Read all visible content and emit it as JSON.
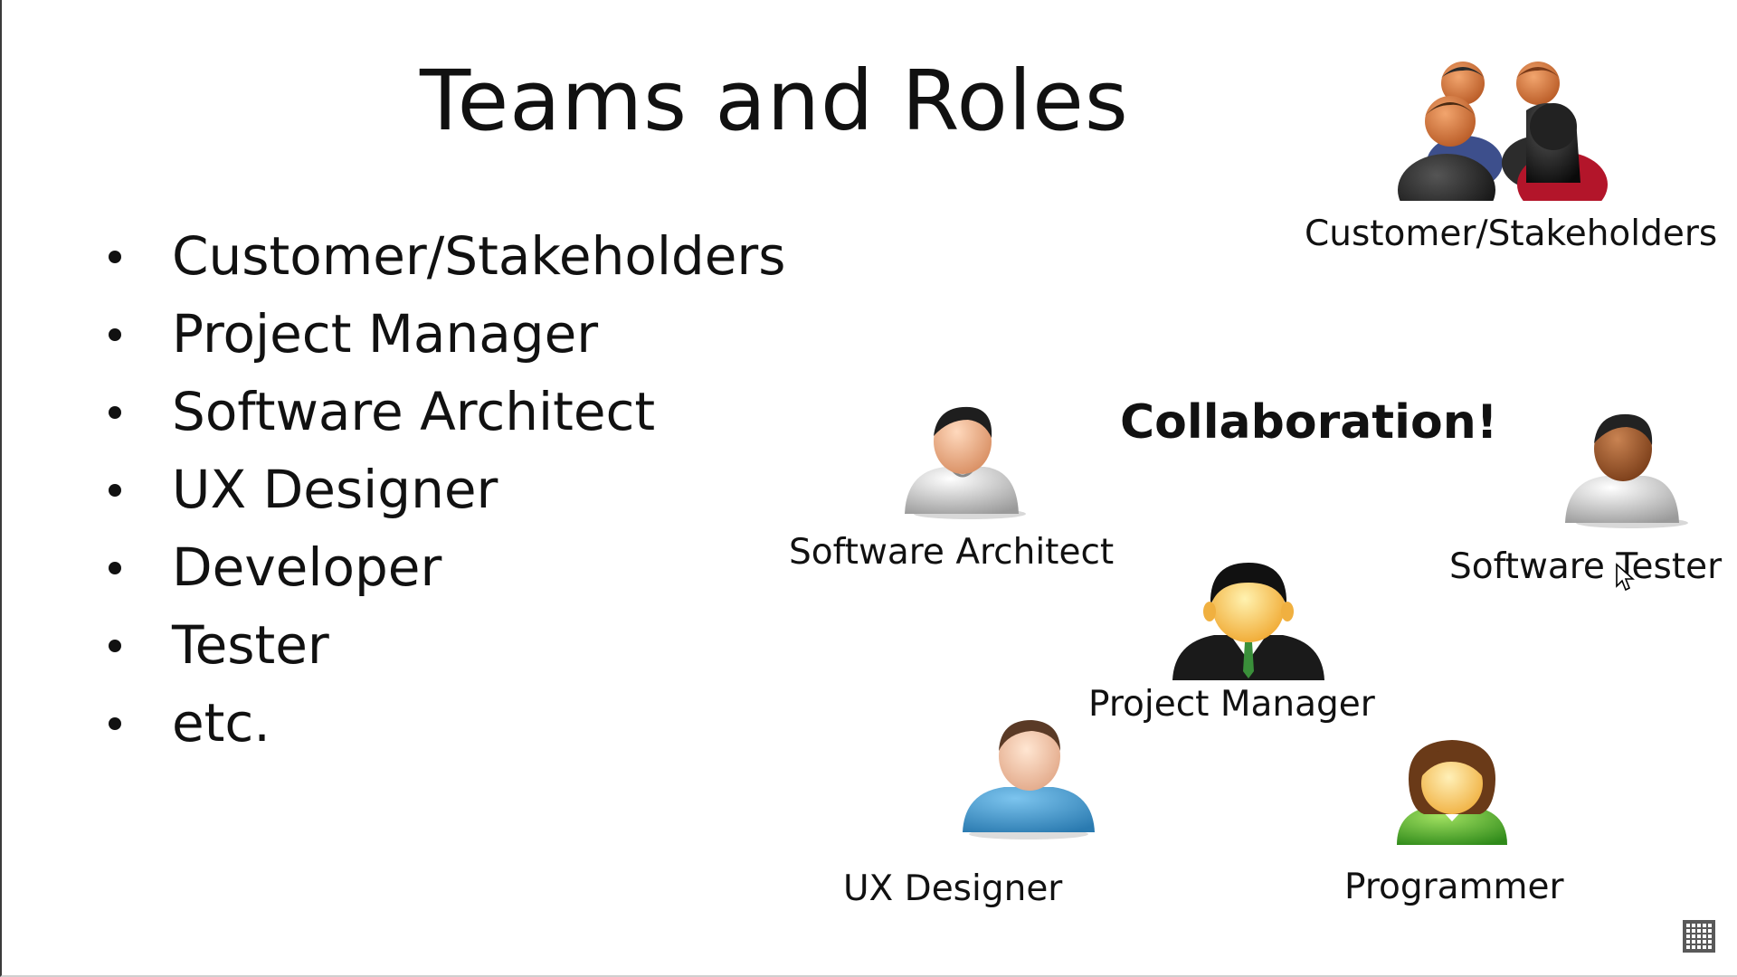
{
  "slide": {
    "title": "Teams and Roles",
    "bullets": [
      "Customer/Stakeholders",
      "Project Manager",
      "Software Architect",
      "UX Designer",
      "Developer",
      "Tester",
      "etc."
    ],
    "collaboration_label": "Collaboration!",
    "figures": [
      {
        "label": "Customer/Stakeholders",
        "icon": "people-group-icon"
      },
      {
        "label": "Software Architect",
        "icon": "person-icon"
      },
      {
        "label": "Software Tester",
        "icon": "person-icon"
      },
      {
        "label": "Project Manager",
        "icon": "manager-icon"
      },
      {
        "label": "UX Designer",
        "icon": "person-icon"
      },
      {
        "label": "Programmer",
        "icon": "person-icon"
      }
    ]
  }
}
